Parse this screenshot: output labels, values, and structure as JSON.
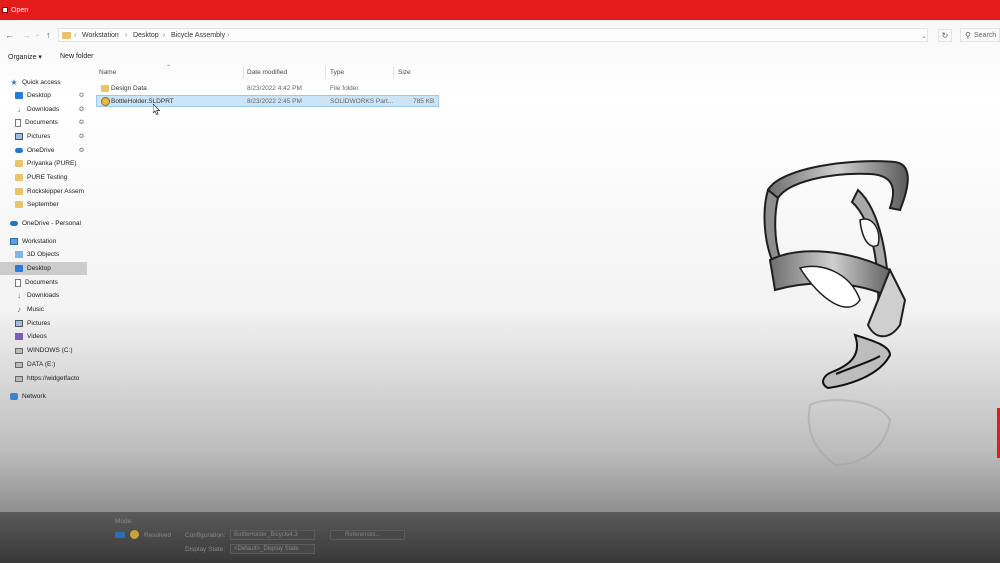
{
  "window": {
    "title": "Open"
  },
  "address": {
    "breadcrumbs": [
      "Workstation",
      "Desktop",
      "Bicycle Assembly"
    ],
    "search_placeholder": "Search"
  },
  "toolbar": {
    "organize": "Organize",
    "new_folder": "New folder"
  },
  "sidebar": {
    "items": [
      {
        "label": "Quick access",
        "icon": "star-icon"
      },
      {
        "label": "Desktop",
        "icon": "desktop-icon",
        "pinned": true
      },
      {
        "label": "Downloads",
        "icon": "download-icon",
        "pinned": true
      },
      {
        "label": "Documents",
        "icon": "document-icon",
        "pinned": true
      },
      {
        "label": "Pictures",
        "icon": "pictures-icon",
        "pinned": true
      },
      {
        "label": "OneDrive",
        "icon": "cloud-icon",
        "pinned": true
      },
      {
        "label": "Priyanka (PURE)",
        "icon": "folder-icon"
      },
      {
        "label": "PURE Testing",
        "icon": "folder-icon"
      },
      {
        "label": "Rockskipper Assem",
        "icon": "folder-icon"
      },
      {
        "label": "September",
        "icon": "folder-icon"
      },
      {
        "label": "OneDrive - Personal",
        "icon": "cloud-icon"
      },
      {
        "label": "Workstation",
        "icon": "computer-icon"
      },
      {
        "label": "3D Objects",
        "icon": "3d-objects-icon"
      },
      {
        "label": "Desktop",
        "icon": "desktop-icon",
        "selected": true
      },
      {
        "label": "Documents",
        "icon": "document-icon"
      },
      {
        "label": "Downloads",
        "icon": "download-icon"
      },
      {
        "label": "Music",
        "icon": "music-icon"
      },
      {
        "label": "Pictures",
        "icon": "pictures-icon"
      },
      {
        "label": "Videos",
        "icon": "video-icon"
      },
      {
        "label": "WINDOWS (C:)",
        "icon": "drive-icon"
      },
      {
        "label": "DATA (E:)",
        "icon": "drive-icon"
      },
      {
        "label": "https://widgetfacto",
        "icon": "network-drive-icon"
      },
      {
        "label": "Network",
        "icon": "network-icon"
      }
    ]
  },
  "file_list": {
    "columns": [
      "Name",
      "Date modified",
      "Type",
      "Size"
    ],
    "rows": [
      {
        "name": "Design Data",
        "date": "8/23/2022 4:42 PM",
        "type": "File folder",
        "size": ""
      },
      {
        "name": "BottleHolder.SLDPRT",
        "date": "8/23/2022 2:45 PM",
        "type": "SOLIDWORKS Part...",
        "size": "785 KB",
        "selected": true
      }
    ]
  },
  "bottom": {
    "mode_label": "Mode",
    "resolved_label": "Resolved",
    "configuration_label": "Configuration:",
    "configuration_value": "BottleHolder_Bicycle4.3",
    "display_state_label": "Display State:",
    "display_state_value": "<Default>_Display State",
    "references_label": "References..."
  }
}
